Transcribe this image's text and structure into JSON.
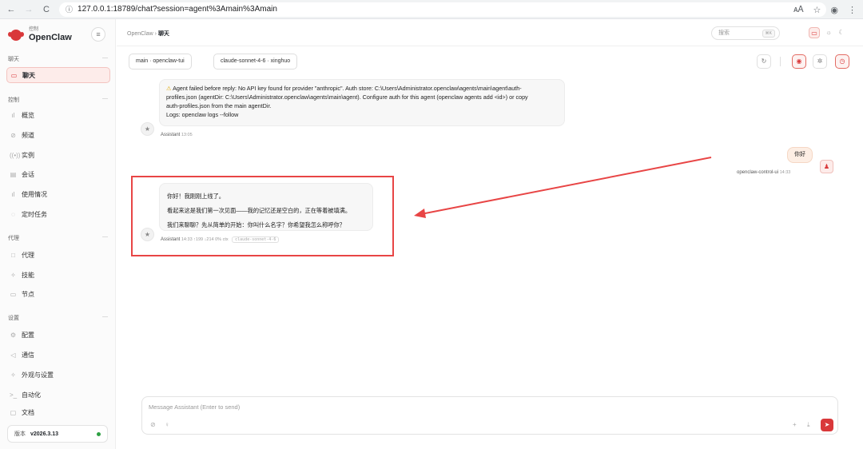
{
  "browser": {
    "back": "←",
    "forward": "→",
    "reload": "C",
    "info_icon": "ⓘ",
    "url": "127.0.0.1:18789/chat?session=agent%3Amain%3Amain",
    "translate": "🗚",
    "star": "☆",
    "profile": "◉",
    "menu": "⋮"
  },
  "brand": {
    "sub": "控制",
    "name": "OpenClaw",
    "collapse": "≡"
  },
  "sidebar": {
    "groups": [
      {
        "label": "聊天",
        "items": [
          {
            "label": "聊天",
            "icon": "▭",
            "active": true
          }
        ]
      },
      {
        "label": "控制",
        "items": [
          {
            "label": "概览",
            "icon": "ıl"
          },
          {
            "label": "频道",
            "icon": "⊘"
          },
          {
            "label": "实例",
            "icon": "((•))"
          },
          {
            "label": "会话",
            "icon": "▤"
          },
          {
            "label": "使用情况",
            "icon": "ıl"
          },
          {
            "label": "定时任务",
            "icon": "◌"
          }
        ]
      },
      {
        "label": "代理",
        "items": [
          {
            "label": "代理",
            "icon": "□"
          },
          {
            "label": "技能",
            "icon": "✧"
          },
          {
            "label": "节点",
            "icon": "▭"
          }
        ]
      },
      {
        "label": "设置",
        "items": [
          {
            "label": "配置",
            "icon": "⚙"
          },
          {
            "label": "通信",
            "icon": "◁"
          },
          {
            "label": "外观与设置",
            "icon": "✧"
          },
          {
            "label": "自动化",
            "icon": ">_"
          },
          {
            "label": "文档",
            "icon": "▢"
          }
        ]
      }
    ],
    "version_label": "版本",
    "version": "v2026.3.13",
    "status_color": "#2ea043"
  },
  "topbar": {
    "crumb_root": "OpenClaw",
    "crumb_sep": "›",
    "crumb_current": "聊天",
    "search_placeholder": "搜索",
    "search_kbd": "⌘K",
    "theme_icons": [
      "▭",
      "☼",
      "☾"
    ]
  },
  "session": {
    "agent_chip": "main · openclaw-tui",
    "model_chip": "claude-sonnet-4-6 · xinghuo",
    "tools": [
      "↻",
      "◉",
      "✲",
      "◷"
    ]
  },
  "messages": {
    "error": {
      "warn_icon": "⚠",
      "lines": [
        "Agent failed before reply: No API key found for provider \"anthropic\". Auth store: C:\\Users\\Administrator.openclaw\\agents\\main\\agent\\auth-",
        "profiles.json (agentDir: C:\\Users\\Administrator.openclaw\\agents\\main\\agent). Configure auth for this agent (openclaw agents add <id>) or copy",
        "auth-profiles.json from the main agentDir.",
        "Logs: openclaw logs --follow"
      ],
      "who": "Assistant",
      "time": "13:05"
    },
    "user": {
      "text": "你好",
      "who": "openclaw-control-ui",
      "time": "14:33"
    },
    "reply": {
      "lines": [
        "你好！我刚刚上线了。",
        "看起来这是我们第一次见面——我的记忆还是空白的，正在等着被填满。",
        "我们来聊聊？先从简单的开始：你叫什么名字？你希望我怎么称呼你？"
      ],
      "who": "Assistant",
      "time": "14:33",
      "tokens_in": "↑199",
      "tokens_out": "↓214",
      "ctx": "0% ctx",
      "model": "claude-sonnet-4-6"
    }
  },
  "composer": {
    "placeholder": "Message Assistant (Enter to send)",
    "attach": "⊘",
    "mic": "♀",
    "plus": "+",
    "download": "⤓",
    "send": "➤"
  },
  "annotation_color": "#e84545"
}
